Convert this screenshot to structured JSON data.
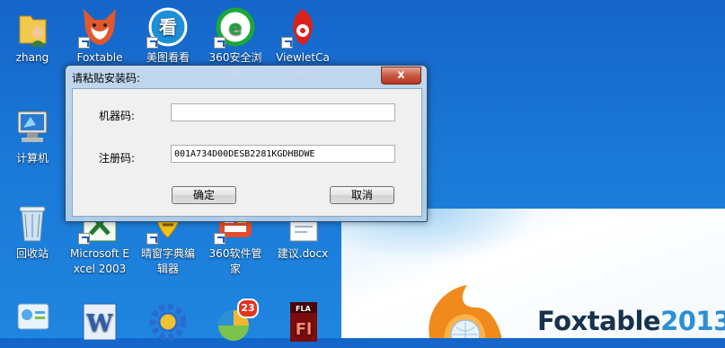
{
  "desktop": {
    "icons": [
      {
        "label": "zhang",
        "icon": "user-folder-icon"
      },
      {
        "label": "Foxtable",
        "icon": "foxtable-icon"
      },
      {
        "label": "美图看看",
        "icon": "meitu-viewer-icon"
      },
      {
        "label": "360安全浏览",
        "icon": "360-browser-icon"
      },
      {
        "label": "ViewletCam",
        "icon": "viewletcam-icon"
      },
      {
        "label": "计算机",
        "icon": "computer-icon"
      },
      {
        "label": "回收站",
        "icon": "recycle-bin-icon"
      },
      {
        "label": "Microsoft Excel 2003",
        "icon": "excel-icon"
      },
      {
        "label": "晴窗字典编辑器",
        "icon": "dictionary-editor-icon"
      },
      {
        "label": "360软件管家",
        "icon": "360-software-manager-icon"
      },
      {
        "label": "建议.docx",
        "icon": "word-document-icon"
      },
      {
        "label": "",
        "icon": "control-panel-icon"
      },
      {
        "label": "",
        "icon": "word-icon"
      },
      {
        "label": "",
        "icon": "settings-gear-icon"
      },
      {
        "label": "",
        "icon": "app-with-badge-icon"
      },
      {
        "label": "",
        "icon": "flash-icon"
      }
    ],
    "badge_count": "23",
    "flash_label": "FLA",
    "flash_letter": "Fl",
    "word_letter": "W"
  },
  "splash": {
    "brand": "Foxtable",
    "year": "2013"
  },
  "dialog": {
    "title": "请粘贴安装码:",
    "close_label": "x",
    "fields": {
      "machine_code_label": "机器码:",
      "machine_code_value": "",
      "registration_code_label": "注册码:",
      "registration_code_value": "001A734D00DESB2281KGDHBDWE"
    },
    "ok_label": "确定",
    "cancel_label": "取消"
  },
  "colors": {
    "desktop_blue": "#1a78d6",
    "title_bar": "#bcd4ec",
    "close_red": "#c75a40"
  }
}
